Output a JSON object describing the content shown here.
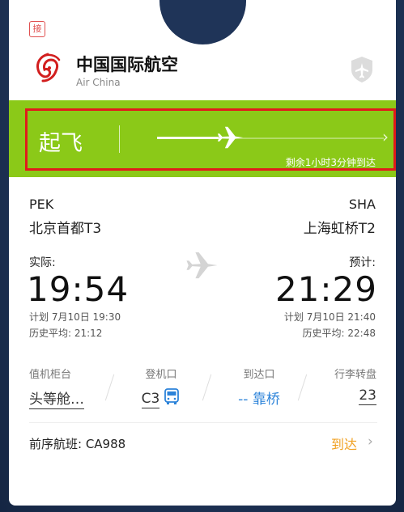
{
  "badge": "接",
  "airline": {
    "name_cn": "中国国际航空",
    "name_en": "Air China"
  },
  "status": {
    "label": "起飞",
    "remaining": "剩余1小时3分钟到达",
    "progress": 0.27
  },
  "departure": {
    "code": "PEK",
    "terminal": "北京首都T3",
    "time_label": "实际:",
    "time": "19:54",
    "planned": "计划 7月10日 19:30",
    "history": "历史平均: 21:12"
  },
  "arrival": {
    "code": "SHA",
    "terminal": "上海虹桥T2",
    "time_label": "预计:",
    "time": "21:29",
    "planned": "计划 7月10日 21:40",
    "history": "历史平均: 22:48"
  },
  "info": {
    "checkin": {
      "label": "值机柜台",
      "value": "头等舱…"
    },
    "gate": {
      "label": "登机口",
      "value": "C3"
    },
    "arrival_gate": {
      "label": "到达口",
      "value_prefix": "--",
      "value": "靠桥"
    },
    "baggage": {
      "label": "行李转盘",
      "value": "23"
    }
  },
  "previous_flight": {
    "label": "前序航班: CA988",
    "status": "到达"
  },
  "colors": {
    "band": "#8bc918",
    "highlight": "#e01b1b",
    "arrive": "#f0a020",
    "link": "#2c83d9"
  },
  "icons": [
    "air-china-logo-icon",
    "shield-plane-icon",
    "plane-icon",
    "bus-icon",
    "chevron-right-icon"
  ]
}
